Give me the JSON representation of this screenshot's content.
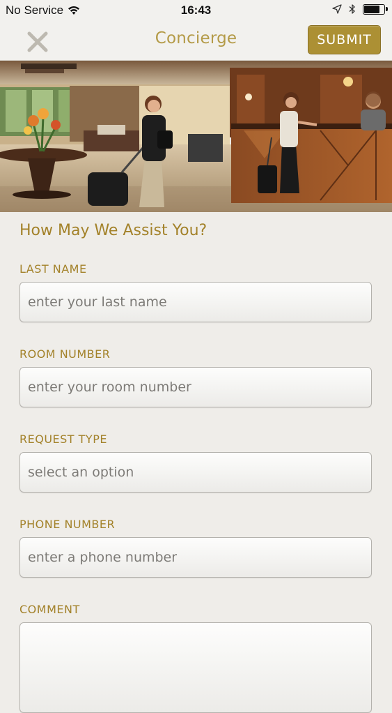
{
  "status_bar": {
    "carrier": "No Service",
    "time": "16:43",
    "battery_level": 0.85
  },
  "nav": {
    "title": "Concierge",
    "close_icon": "close-x-icon",
    "submit_label": "SUBMIT"
  },
  "form": {
    "title": "How May We Assist You?",
    "fields": [
      {
        "label": "LAST NAME",
        "placeholder": "enter your last name"
      },
      {
        "label": "ROOM NUMBER",
        "placeholder": "enter your room number"
      },
      {
        "label": "REQUEST TYPE",
        "placeholder": "select an option"
      },
      {
        "label": "PHONE NUMBER",
        "placeholder": "enter a phone number"
      },
      {
        "label": "COMMENT",
        "placeholder": ""
      }
    ]
  },
  "colors": {
    "accent_gold": "#ac9034",
    "label_gold": "#a3822a",
    "background": "#efede9"
  }
}
